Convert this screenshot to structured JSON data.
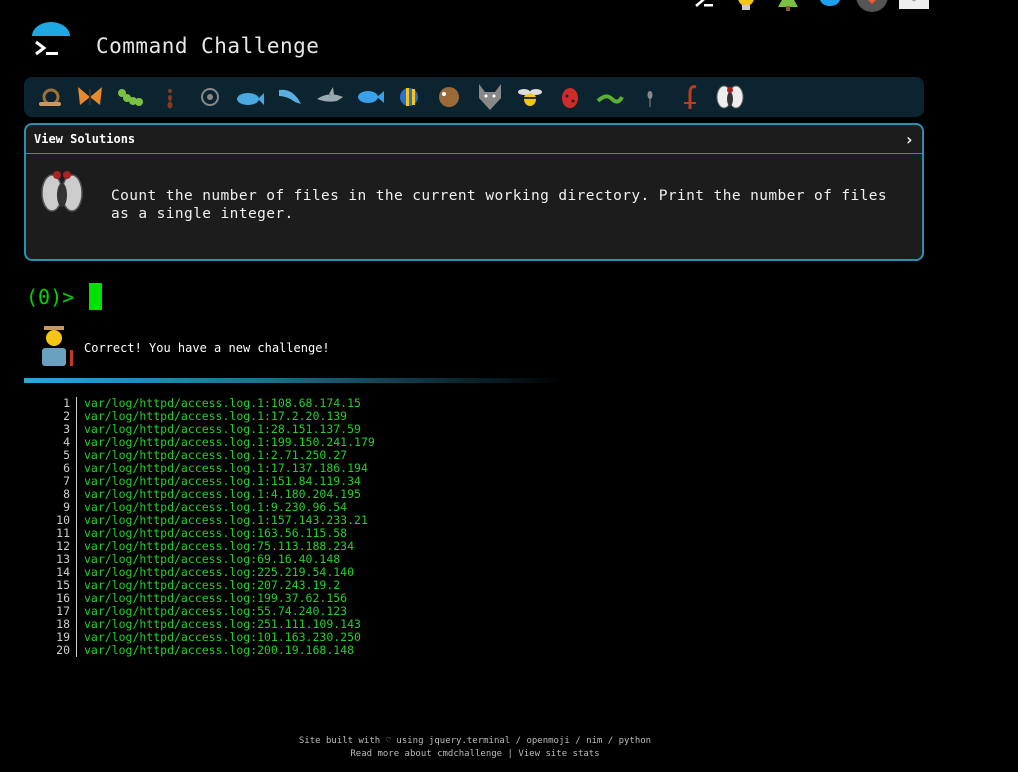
{
  "title": "Command Challenge",
  "panel": {
    "header": "View Solutions",
    "chevron": "›",
    "task": "Count the number of files in the current working directory. Print the number of files as a single integer."
  },
  "prompt": "(0)>",
  "message": "Correct! You have a new challenge!",
  "output": [
    {
      "n": "1",
      "v": "var/log/httpd/access.log.1:108.68.174.15"
    },
    {
      "n": "2",
      "v": "var/log/httpd/access.log.1:17.2.20.139"
    },
    {
      "n": "3",
      "v": "var/log/httpd/access.log.1:28.151.137.59"
    },
    {
      "n": "4",
      "v": "var/log/httpd/access.log.1:199.150.241.179"
    },
    {
      "n": "5",
      "v": "var/log/httpd/access.log.1:2.71.250.27"
    },
    {
      "n": "6",
      "v": "var/log/httpd/access.log.1:17.137.186.194"
    },
    {
      "n": "7",
      "v": "var/log/httpd/access.log.1:151.84.119.34"
    },
    {
      "n": "8",
      "v": "var/log/httpd/access.log.1:4.180.204.195"
    },
    {
      "n": "9",
      "v": "var/log/httpd/access.log.1:9.230.96.54"
    },
    {
      "n": "10",
      "v": "var/log/httpd/access.log.1:157.143.233.21"
    },
    {
      "n": "11",
      "v": "var/log/httpd/access.log:163.56.115.58"
    },
    {
      "n": "12",
      "v": "var/log/httpd/access.log:75.113.188.234"
    },
    {
      "n": "13",
      "v": "var/log/httpd/access.log:69.16.40.148"
    },
    {
      "n": "14",
      "v": "var/log/httpd/access.log:225.219.54.140"
    },
    {
      "n": "15",
      "v": "var/log/httpd/access.log:207.243.19.2"
    },
    {
      "n": "16",
      "v": "var/log/httpd/access.log:199.37.62.156"
    },
    {
      "n": "17",
      "v": "var/log/httpd/access.log:55.74.240.123"
    },
    {
      "n": "18",
      "v": "var/log/httpd/access.log:251.111.109.143"
    },
    {
      "n": "19",
      "v": "var/log/httpd/access.log:101.163.230.250"
    },
    {
      "n": "20",
      "v": "var/log/httpd/access.log:200.19.168.148"
    }
  ],
  "footer": {
    "line1": "Site built with ♡ using jquery.terminal / openmoji / nim / python",
    "line2": "Read more about cmdchallenge | View site stats"
  },
  "top_icons": [
    "terminal-icon",
    "lightbulb-icon",
    "tree-icon",
    "twitter-icon",
    "brave-icon",
    "mail-icon"
  ],
  "emoji_icons": [
    "snail-icon",
    "butterfly-icon",
    "caterpillar-icon",
    "ant-icon",
    "shell-icon",
    "whale-icon",
    "dolphin-icon",
    "shark-icon",
    "fish-icon",
    "tropical-fish-icon",
    "pufferfish-icon",
    "wolf-icon",
    "bee-icon",
    "ladybug-icon",
    "worm-icon",
    "mosquito-icon",
    "scorpion-icon",
    "fly-icon"
  ],
  "colors": {
    "accent": "#2a8fb0",
    "terminal_green": "#22d02a",
    "bar": "#0b2430"
  }
}
